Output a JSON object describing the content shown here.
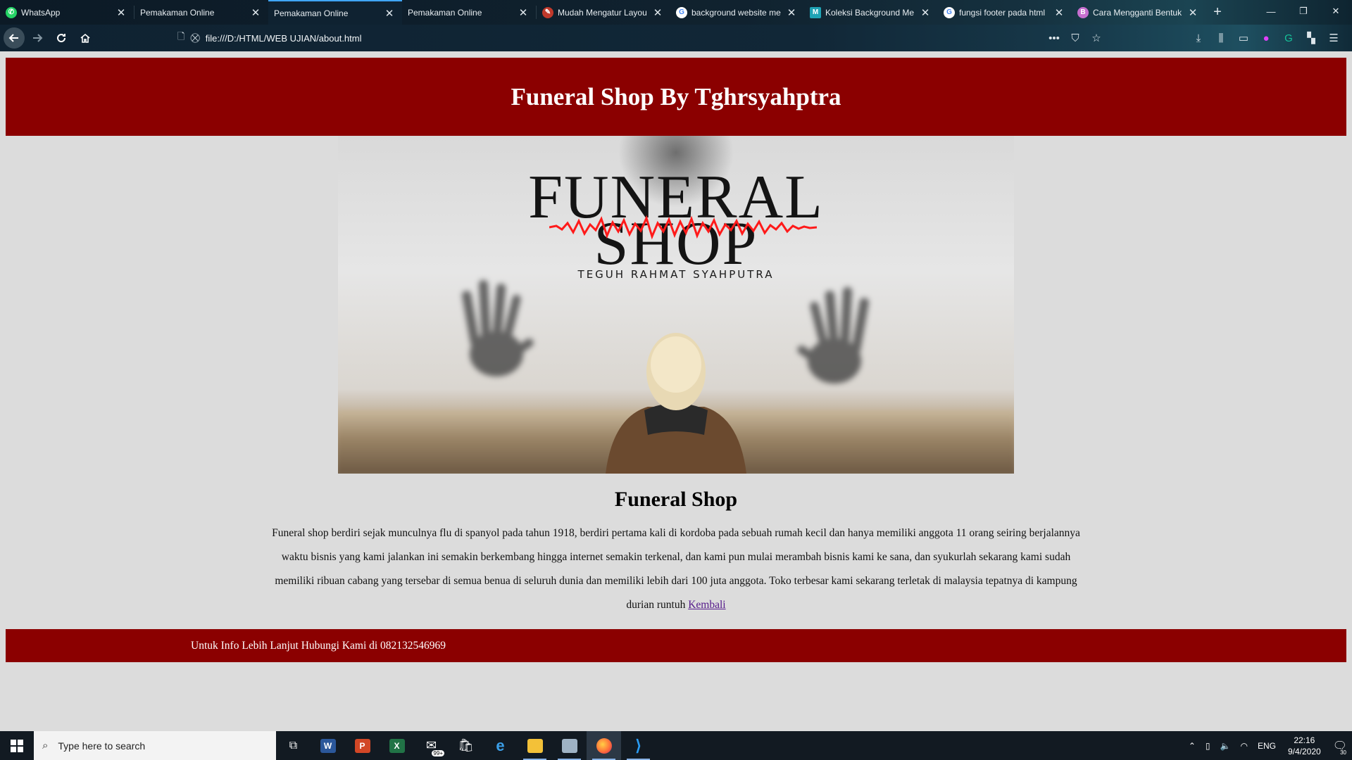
{
  "browser": {
    "tabs": [
      {
        "label": "WhatsApp",
        "favicon": "whatsapp-icon",
        "color": "#25d366"
      },
      {
        "label": "Pemakaman Online",
        "favicon": "",
        "color": ""
      },
      {
        "label": "Pemakaman Online",
        "favicon": "",
        "color": "",
        "active": true
      },
      {
        "label": "Pemakaman Online",
        "favicon": "",
        "color": ""
      },
      {
        "label": "Mudah Mengatur Layou",
        "favicon": "feather-icon",
        "color": "#c0392b"
      },
      {
        "label": "background website me",
        "favicon": "google-icon",
        "color": "#ffffff"
      },
      {
        "label": "Koleksi Background Me",
        "favicon": "m-icon",
        "color": "#1fa3b5"
      },
      {
        "label": "fungsi footer pada html",
        "favicon": "google-icon",
        "color": "#ffffff"
      },
      {
        "label": "Cara Mengganti Bentuk",
        "favicon": "b-icon",
        "color": "#c76fd0"
      }
    ],
    "url": "file:///D:/HTML/WEB UJIAN/about.html"
  },
  "page": {
    "header_title": "Funeral Shop By Tghrsyahptra",
    "hero_logo_line1": "FUNERAL",
    "hero_logo_line2": "SHOP",
    "hero_logo_subtitle": "TEGUH RAHMAT SYAHPUTRA",
    "section_title": "Funeral Shop",
    "paragraph": "Funeral shop berdiri sejak munculnya flu di spanyol pada tahun 1918, berdiri pertama kali di kordoba pada sebuah rumah kecil dan hanya memiliki anggota 11 orang seiring berjalannya waktu bisnis yang kami jalankan ini semakin berkembang hingga internet semakin terkenal, dan kami pun mulai merambah bisnis kami ke sana, dan syukurlah sekarang kami sudah memiliki ribuan cabang yang tersebar di semua benua di seluruh dunia dan memiliki lebih dari 100 juta anggota. Toko terbesar kami sekarang terletak di malaysia tepatnya di kampung durian runtuh",
    "back_link": "Kembali",
    "footer_text": "Untuk Info Lebih Lanjut Hubungi Kami di 082132546969",
    "brand_color": "#8b0000"
  },
  "taskbar": {
    "search_placeholder": "Type here to search",
    "mail_badge": "99+",
    "language": "ENG",
    "time": "22:16",
    "date": "9/4/2020",
    "notification_count": "30"
  }
}
